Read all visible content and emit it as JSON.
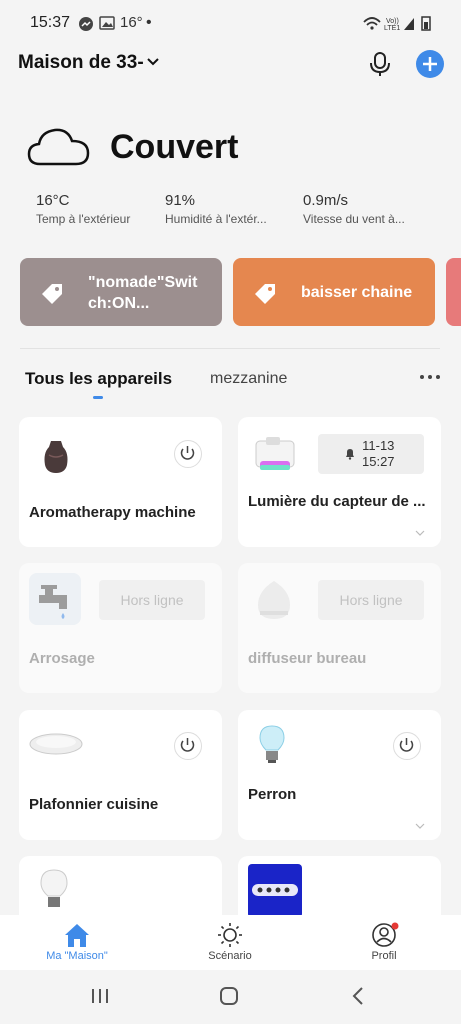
{
  "status": {
    "time": "15:37",
    "temp": "16°",
    "dot": "•"
  },
  "header": {
    "home_name": "Maison de 33-"
  },
  "weather": {
    "condition": "Couvert",
    "stats": [
      {
        "value": "16°C",
        "label": "Temp à l'extérieur"
      },
      {
        "value": "91%",
        "label": "Humidité à l'extér..."
      },
      {
        "value": "0.9m/s",
        "label": "Vitesse du vent à..."
      }
    ]
  },
  "scenes": [
    {
      "line1": "\"nomade\"Swit",
      "line2": "ch:ON...",
      "color": "#9c8f8f"
    },
    {
      "line1": "baisser chaine",
      "line2": "",
      "color": "#e5874f"
    },
    {
      "line1": "",
      "line2": "",
      "color": "#e77a7a"
    }
  ],
  "tabs": {
    "active": "Tous les appareils",
    "other": "mezzanine"
  },
  "devices": [
    {
      "name": "Aromatherapy machine"
    },
    {
      "name": "Lumière du capteur de ...",
      "chip_date": "11-13",
      "chip_time": "15:27"
    },
    {
      "name": "Arrosage",
      "status": "Hors ligne"
    },
    {
      "name": "diffuseur bureau",
      "status": "Hors ligne"
    },
    {
      "name": "Plafonnier cuisine"
    },
    {
      "name": "Perron"
    },
    {
      "name": ""
    },
    {
      "name": ""
    }
  ],
  "nav": {
    "home": "Ma \"Maison\"",
    "scenario": "Scénario",
    "profile": "Profil"
  },
  "colors": {
    "accent": "#3f8ae8",
    "notification": "#e53935"
  }
}
